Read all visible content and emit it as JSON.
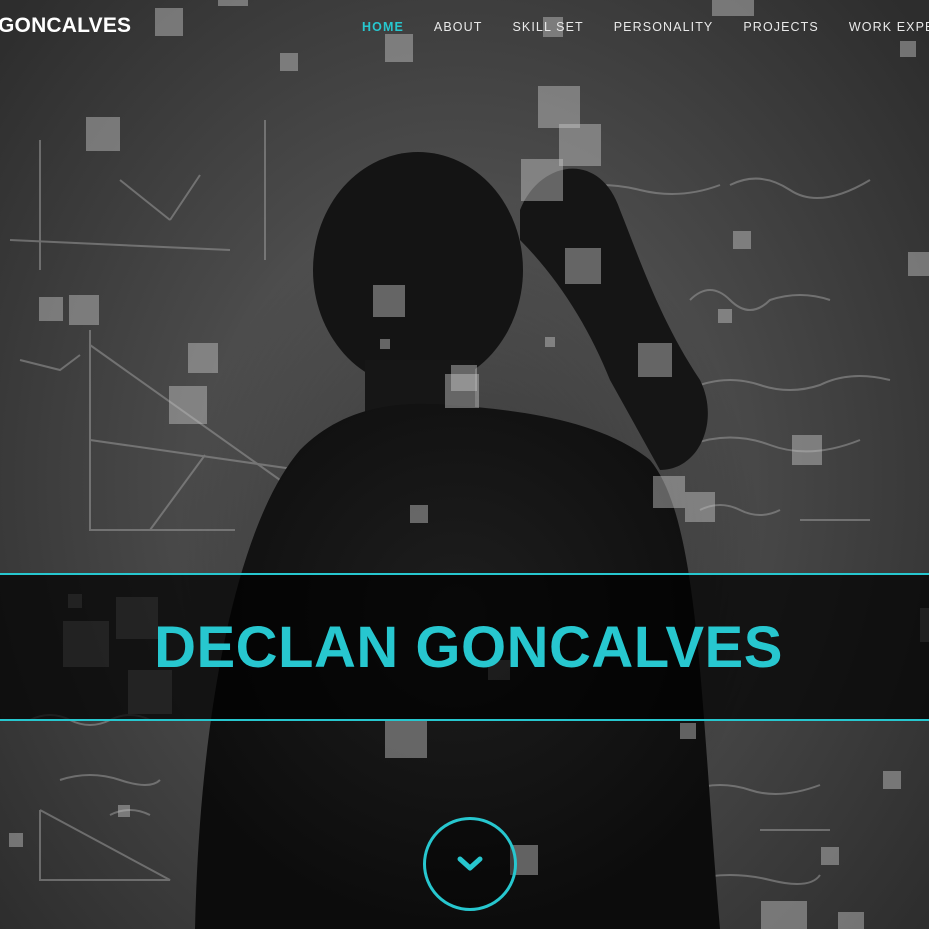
{
  "brand": {
    "name": "GONCALVES"
  },
  "nav": {
    "items": [
      {
        "label": "HOME",
        "active": true
      },
      {
        "label": "ABOUT",
        "active": false
      },
      {
        "label": "SKILL SET",
        "active": false
      },
      {
        "label": "PERSONALITY",
        "active": false
      },
      {
        "label": "PROJECTS",
        "active": false
      },
      {
        "label": "WORK EXPERIEN",
        "active": false
      }
    ]
  },
  "hero": {
    "title": "DECLAN GONCALVES",
    "scroll_icon": "chevron-down-icon"
  },
  "colors": {
    "accent": "#27c7cf",
    "band_bg": "#000000",
    "nav_text": "#e9e9e9"
  }
}
